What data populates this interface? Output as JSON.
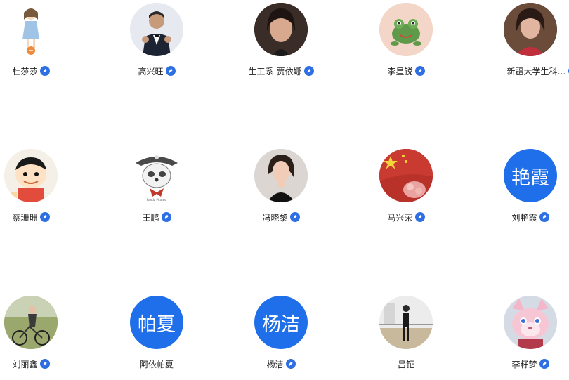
{
  "members": [
    {
      "name": "杜莎莎",
      "verified": true,
      "avatar": "illustration-girl"
    },
    {
      "name": "高兴旺",
      "verified": true,
      "avatar": "photo-man-suit"
    },
    {
      "name": "生工系-贾依娜",
      "verified": true,
      "avatar": "photo-woman"
    },
    {
      "name": "李星锐",
      "verified": true,
      "avatar": "frog-image"
    },
    {
      "name": "新疆大学生科…",
      "verified": true,
      "avatar": "photo-woman-red"
    },
    {
      "name": "蔡珊珊",
      "verified": true,
      "avatar": "cartoon-boy"
    },
    {
      "name": "王鹏",
      "verified": true,
      "avatar": "sketch-panda-pirate"
    },
    {
      "name": "冯晓黎",
      "verified": true,
      "avatar": "photo-woman-black"
    },
    {
      "name": "马兴荣",
      "verified": true,
      "avatar": "flag-image"
    },
    {
      "name": "刘艳霞",
      "verified": true,
      "avatar_text": "艳霞"
    },
    {
      "name": "刘丽鑫",
      "verified": true,
      "avatar": "photo-bicycle"
    },
    {
      "name": "阿依帕夏",
      "verified": false,
      "avatar_text": "帕夏"
    },
    {
      "name": "杨洁",
      "verified": true,
      "avatar_text": "杨洁"
    },
    {
      "name": "吕钲",
      "verified": false,
      "avatar": "photo-dance-studio"
    },
    {
      "name": "李籽梦",
      "verified": true,
      "avatar": "plush-toy"
    }
  ],
  "colors": {
    "text_avatar_bg": "#1f6fea",
    "badge": "#2f6fe4",
    "name_text": "#222222"
  }
}
